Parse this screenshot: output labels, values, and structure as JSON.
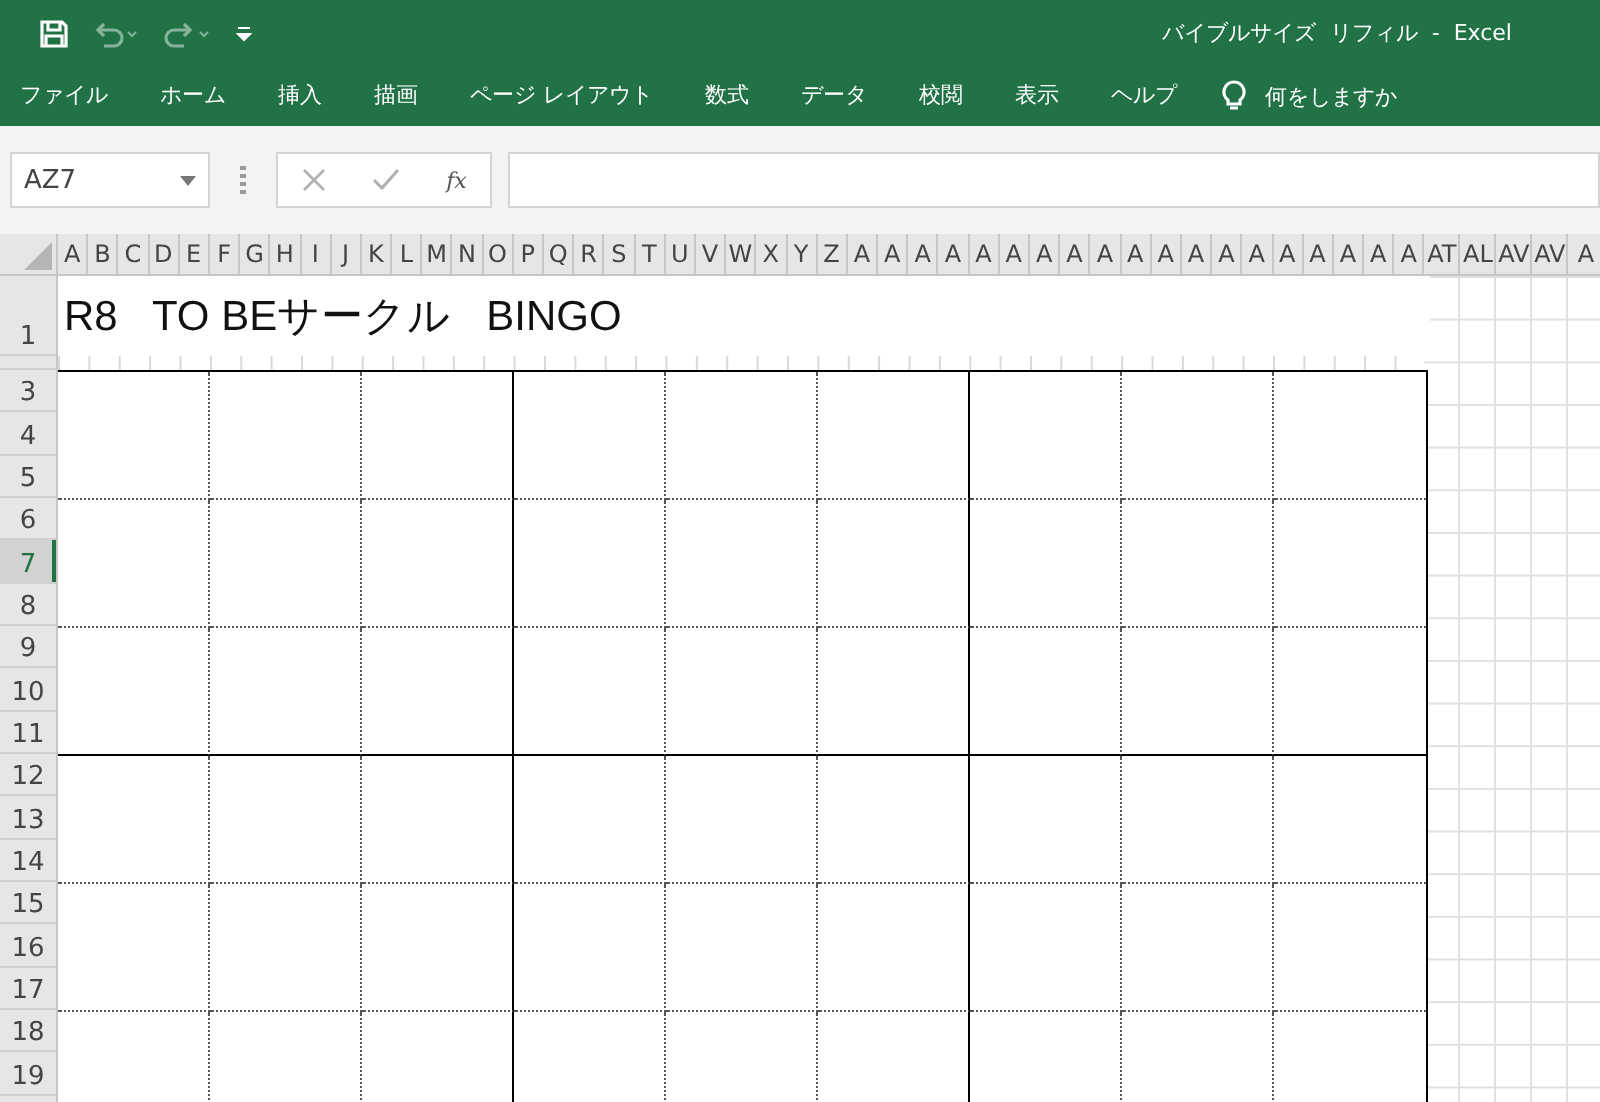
{
  "window": {
    "title": "バイブルサイズ  リフィル  -  Excel"
  },
  "quick_access": {
    "undo_disabled": true,
    "redo_disabled": true
  },
  "ribbon_tabs": [
    {
      "label": "ファイル",
      "selected": false
    },
    {
      "label": "ホーム",
      "selected": false
    },
    {
      "label": "挿入",
      "selected": false
    },
    {
      "label": "描画",
      "selected": false
    },
    {
      "label": "ページ レイアウト",
      "selected": false
    },
    {
      "label": "数式",
      "selected": false
    },
    {
      "label": "データ",
      "selected": false
    },
    {
      "label": "校閲",
      "selected": false
    },
    {
      "label": "表示",
      "selected": false
    },
    {
      "label": "ヘルプ",
      "selected": false
    }
  ],
  "tell_me": {
    "placeholder": "何をしますか"
  },
  "formula_bar": {
    "name_box": "AZ7",
    "fx": "fx"
  },
  "column_headers": [
    "A",
    "B",
    "C",
    "D",
    "E",
    "F",
    "G",
    "H",
    "I",
    "J",
    "K",
    "L",
    "M",
    "N",
    "O",
    "P",
    "Q",
    "R",
    "S",
    "T",
    "U",
    "V",
    "W",
    "X",
    "Y",
    "Z",
    "A",
    "A",
    "A",
    "A",
    "A",
    "A",
    "A",
    "A",
    "A",
    "A",
    "A",
    "A",
    "A",
    "A",
    "A",
    "A",
    "A",
    "A",
    "A",
    "AT",
    "AL",
    "AV",
    "AV",
    "A"
  ],
  "row_headers": [
    {
      "label": "1",
      "selected": false
    },
    {
      "label": "3",
      "selected": false
    },
    {
      "label": "4",
      "selected": false
    },
    {
      "label": "5",
      "selected": false
    },
    {
      "label": "6",
      "selected": false
    },
    {
      "label": "7",
      "selected": true
    },
    {
      "label": "8",
      "selected": false
    },
    {
      "label": "9",
      "selected": false
    },
    {
      "label": "10",
      "selected": false
    },
    {
      "label": "11",
      "selected": false
    },
    {
      "label": "12",
      "selected": false
    },
    {
      "label": "13",
      "selected": false
    },
    {
      "label": "14",
      "selected": false
    },
    {
      "label": "15",
      "selected": false
    },
    {
      "label": "16",
      "selected": false
    },
    {
      "label": "17",
      "selected": false
    },
    {
      "label": "18",
      "selected": false
    },
    {
      "label": "19",
      "selected": false
    }
  ],
  "sheet_title": "R8   TO BEサークル   BINGO"
}
